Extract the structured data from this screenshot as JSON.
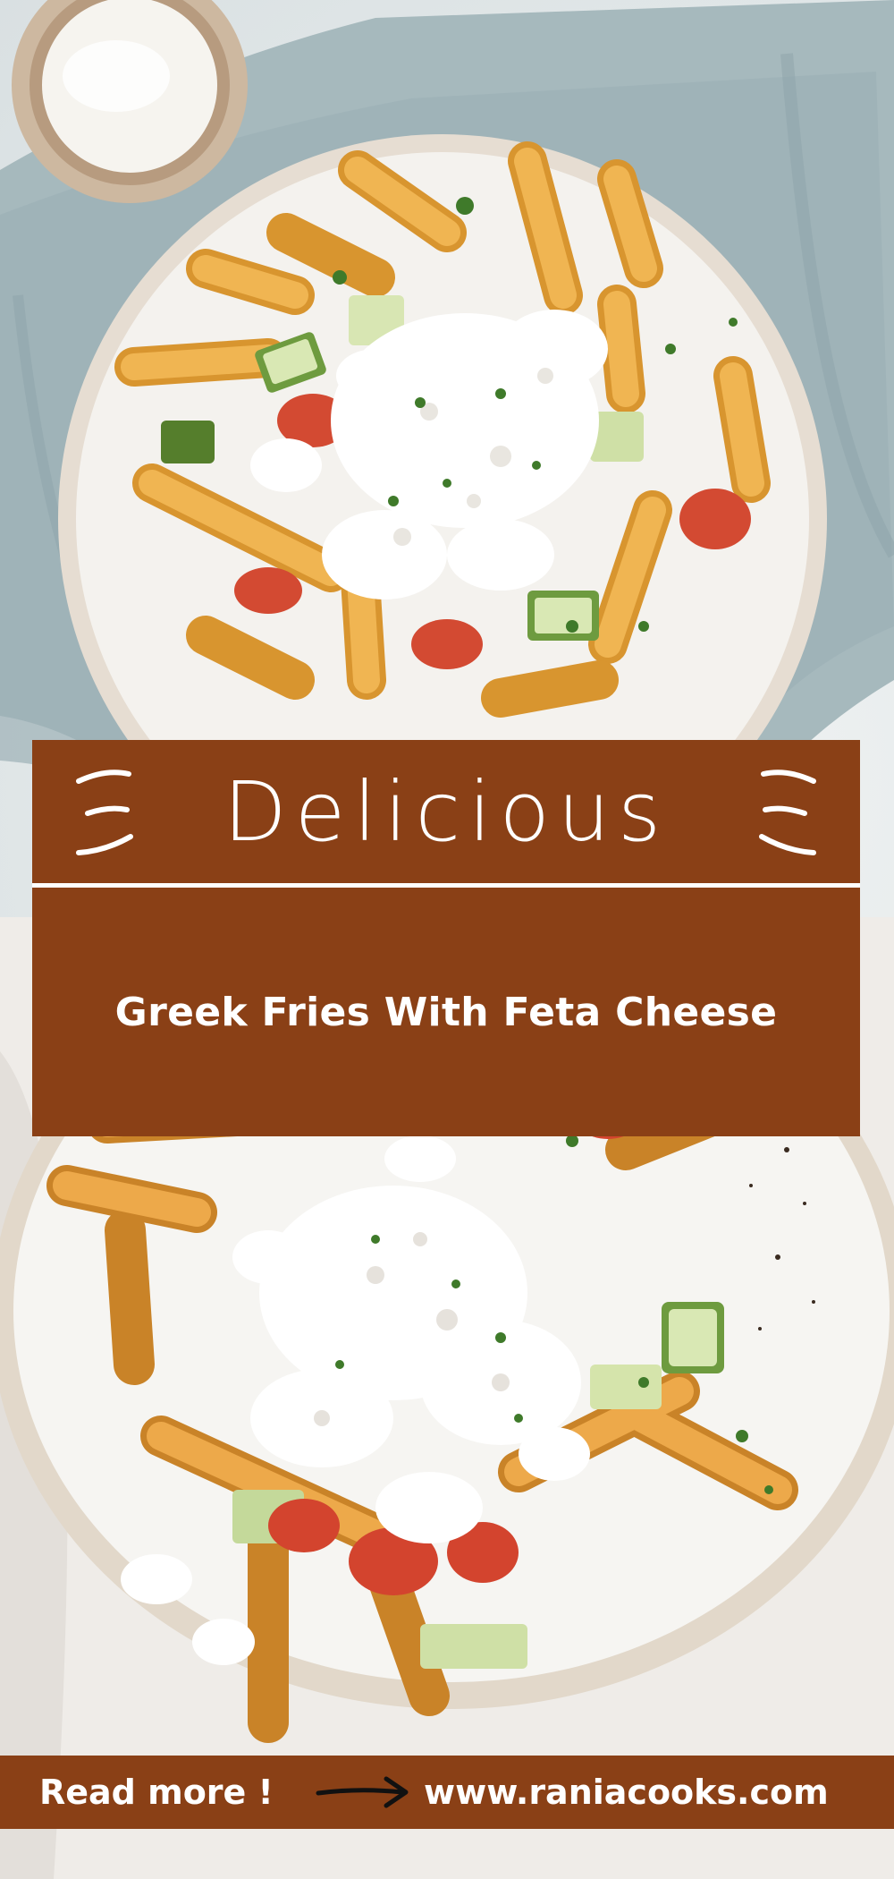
{
  "banner": {
    "title": "Delicious",
    "subtitle": "Greek Fries With Feta Cheese"
  },
  "footer": {
    "read_more": "Read more !",
    "url": "www.raniacooks.com"
  },
  "colors": {
    "banner_brown": "#8a4016",
    "text": "#ffffff",
    "napkin": "#9fb4b9",
    "plate": "#f4f2ee",
    "fries": "#e2a43e"
  },
  "icons": [
    "sparkle-swoosh-left-icon",
    "sparkle-swoosh-right-icon",
    "arrow-right-icon"
  ]
}
